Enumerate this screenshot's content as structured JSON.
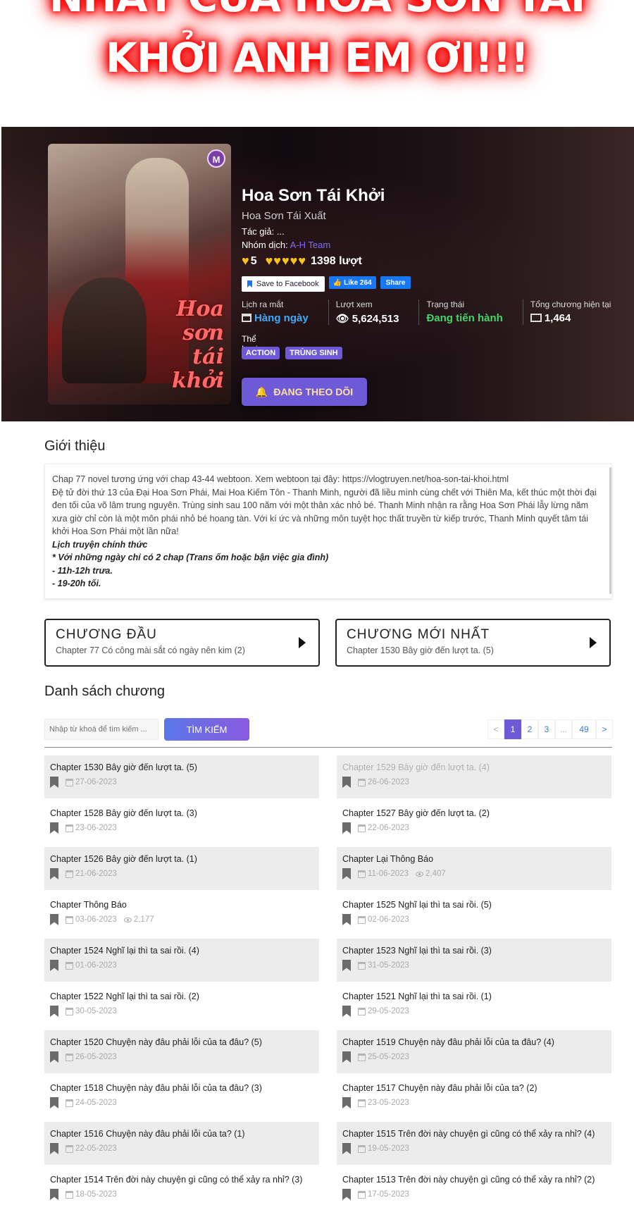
{
  "banner": {
    "line1": "NHẤT CỦA HOA SƠN TÁI",
    "line2": "KHỞI ANH EM ƠI!!!"
  },
  "cover": {
    "badge": "M",
    "title": "Hoa sơn tái khởi"
  },
  "manga": {
    "title": "Hoa Sơn Tái Khởi",
    "alt_title": "Hoa Sơn Tái Xuất",
    "author_label": "Tác giả:",
    "author_value": "...",
    "group_label": "Nhóm dịch:",
    "group_value": "A-H Team",
    "rating_score": "5",
    "rating_count": "1398 lượt",
    "save_facebook": "Save to Facebook",
    "like_label": "Like 264",
    "share_label": "Share",
    "stats": [
      {
        "label": "Lịch ra mắt",
        "value": "Hàng ngày"
      },
      {
        "label": "Lượt xem",
        "value": "5,624,513"
      },
      {
        "label": "Trạng thái",
        "value": "Đang tiến hành"
      },
      {
        "label": "Tổng chương hiện tại",
        "value": "1,464"
      }
    ],
    "genre_label": "Thể Loại",
    "genres": [
      "ACTION",
      "TRÙNG SINH"
    ],
    "follow_label": "ĐANG THEO DÕI",
    "colors": {
      "accent": "#6e5ad6",
      "rating": "#ffc21a",
      "status": "#47d46a",
      "schedule": "#3fa9f5"
    }
  },
  "intro": {
    "heading": "Giới thiệu",
    "p1": "Chap 77 novel tương ứng với chap 43-44 webtoon. Xem webtoon tại đây: https://vlogtruyen.net/hoa-son-tai-khoi.html",
    "p2": "Đệ tử đời thứ 13 của Đại Hoa Sơn Phái, Mai Hoa Kiếm Tôn - Thanh Minh, người đã liều mình cùng chết với Thiên Ma, kết thúc một thời đại đen tối của võ lâm trung nguyên. Trùng sinh sau 100 năm với một thân xác nhỏ bé. Thanh Minh nhận ra rằng Hoa Sơn Phái lẫy lừng năm xưa giờ chỉ còn là một môn phái nhỏ bé hoang tàn. Với kí ức và những môn tuyệt học thất truyền từ kiếp trước, Thanh Minh quyết tâm tái khởi Hoa Sơn Phái một lần nữa!",
    "schedule_title": "Lịch truyện chính thức",
    "schedule_1": "* Với những ngày chỉ có 2 chap (Trans ốm hoặc bận việc gia đình)",
    "schedule_2": "- 11h-12h trưa.",
    "schedule_3": "- 19-20h tối."
  },
  "first_chapter": {
    "title": "CHƯƠNG ĐẦU",
    "subtitle": "Chapter 77 Có công mài sắt có ngày nên kim (2)"
  },
  "latest_chapter": {
    "title": "CHƯƠNG MỚI NHẤT",
    "subtitle": "Chapter 1530 Bây giờ đến lượt ta. (5)"
  },
  "chapter_list": {
    "heading": "Danh sách chương",
    "search_placeholder": "Nhập từ khoá để tìm kiếm ...",
    "search_button": "TÌM KIẾM",
    "pagination": [
      "<",
      "1",
      "2",
      "3",
      "...",
      "49",
      ">"
    ],
    "current_page": "1",
    "chapters": [
      {
        "name": "Chapter 1530 Bây giờ đến lượt ta. (5)",
        "date": "27-06-2023",
        "views": "",
        "read": false
      },
      {
        "name": "Chapter 1529 Bây giờ đến lượt ta. (4)",
        "date": "26-06-2023",
        "views": "",
        "read": true
      },
      {
        "name": "Chapter 1528 Bây giờ đến lượt ta. (3)",
        "date": "23-06-2023",
        "views": "",
        "read": false
      },
      {
        "name": "Chapter 1527 Bây giờ đến lượt ta. (2)",
        "date": "22-06-2023",
        "views": "",
        "read": false
      },
      {
        "name": "Chapter 1526 Bây giờ đến lượt ta. (1)",
        "date": "21-06-2023",
        "views": "",
        "read": false
      },
      {
        "name": "Chapter Lại Thông Báo",
        "date": "11-06-2023",
        "views": "2,407",
        "read": false
      },
      {
        "name": "Chapter Thông Báo",
        "date": "03-06-2023",
        "views": "2,177",
        "read": false
      },
      {
        "name": "Chapter 1525 Nghĩ lại thì ta sai rồi. (5)",
        "date": "02-06-2023",
        "views": "",
        "read": false
      },
      {
        "name": "Chapter 1524 Nghĩ lại thì ta sai rồi. (4)",
        "date": "01-06-2023",
        "views": "",
        "read": false
      },
      {
        "name": "Chapter 1523 Nghĩ lại thì ta sai rồi. (3)",
        "date": "31-05-2023",
        "views": "",
        "read": false
      },
      {
        "name": "Chapter 1522 Nghĩ lại thì ta sai rồi. (2)",
        "date": "30-05-2023",
        "views": "",
        "read": false
      },
      {
        "name": "Chapter 1521 Nghĩ lại thì ta sai rồi. (1)",
        "date": "29-05-2023",
        "views": "",
        "read": false
      },
      {
        "name": "Chapter 1520 Chuyện này đâu phải lỗi của ta đâu? (5)",
        "date": "26-05-2023",
        "views": "",
        "read": false
      },
      {
        "name": "Chapter 1519 Chuyện này đâu phải lỗi của ta đâu? (4)",
        "date": "25-05-2023",
        "views": "",
        "read": false
      },
      {
        "name": "Chapter 1518 Chuyện này đâu phải lỗi của ta đâu? (3)",
        "date": "24-05-2023",
        "views": "",
        "read": false
      },
      {
        "name": "Chapter 1517 Chuyện này đâu phải lỗi của ta? (2)",
        "date": "23-05-2023",
        "views": "",
        "read": false
      },
      {
        "name": "Chapter 1516 Chuyện này đâu phải lỗi của ta? (1)",
        "date": "22-05-2023",
        "views": "",
        "read": false
      },
      {
        "name": "Chapter 1515 Trên đời này chuyện gì cũng có thể xảy ra nhỉ? (4)",
        "date": "19-05-2023",
        "views": "",
        "read": false
      },
      {
        "name": "Chapter 1514 Trên đời này chuyện gì cũng có thể xảy ra nhỉ? (3)",
        "date": "18-05-2023",
        "views": "",
        "read": false
      },
      {
        "name": "Chapter 1513 Trên đời này chuyện gì cũng có thể xảy ra nhỉ? (2)",
        "date": "17-05-2023",
        "views": "",
        "read": false
      }
    ]
  }
}
